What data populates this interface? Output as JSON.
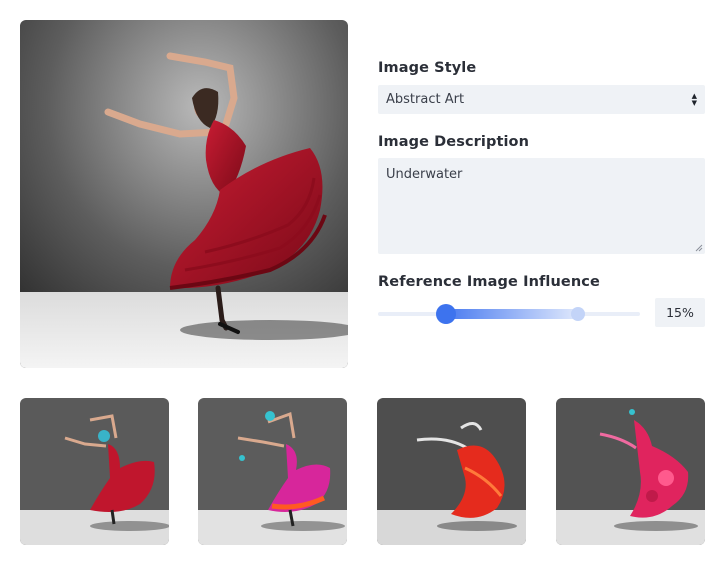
{
  "form": {
    "style_label": "Image Style",
    "style_value": "Abstract Art",
    "description_label": "Image Description",
    "description_value": "Underwater",
    "influence_label": "Reference Image Influence",
    "influence_value": "15%",
    "influence_level": 0.15
  },
  "images": {
    "reference_alt": "flamenco-dancer-photo",
    "thumbnails": [
      "dancer-variation-1",
      "dancer-variation-2",
      "dancer-variation-3",
      "dancer-variation-4"
    ]
  },
  "colors": {
    "accent": "#3d73ee",
    "field_bg": "#eff2f6",
    "dress_red": "#b8152a"
  }
}
